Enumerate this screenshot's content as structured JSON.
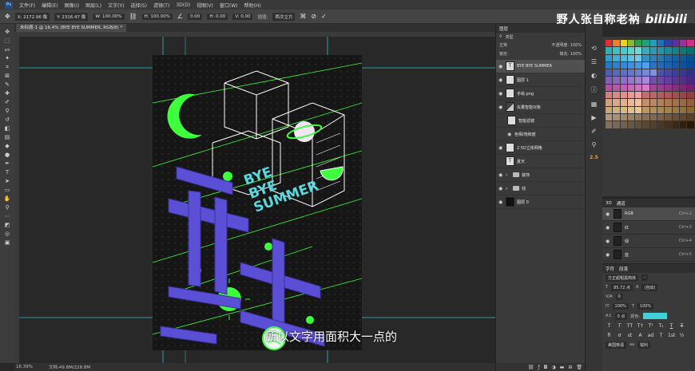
{
  "menubar": {
    "logo": "Ps",
    "items": [
      "文件(F)",
      "编辑(E)",
      "图像(I)",
      "图层(L)",
      "文字(Y)",
      "选择(S)",
      "滤镜(T)",
      "3D(D)",
      "视图(V)",
      "窗口(W)",
      "帮助(H)"
    ]
  },
  "options": {
    "x": "X: 2172.96 像",
    "y": "Y: 2316.47 像",
    "w": "W: 100.00%",
    "h": "H: 100.00%",
    "angle": "0.00",
    "hskew": "H: 0.00",
    "vskew": "V: 0.00",
    "interp_label": "插值:",
    "interp_value": "两次立方"
  },
  "watermark": {
    "text": "野人张自称老衲",
    "logo": "bilibili"
  },
  "document": {
    "tab_title": "未标题-1 @ 16.4% (BYE BYE SUMMER, RGB/8) *"
  },
  "poster": {
    "text_lines": [
      "BYE",
      "BYE",
      "SUMMER"
    ],
    "colors": {
      "green": "#3dff3d",
      "purple": "#5b4fd6",
      "cyan": "#5ad8e0"
    }
  },
  "subtitle": "所以文字用面积大一点的",
  "status": {
    "zoom": "16.39%",
    "doc": "文档:49.8M/228.8M"
  },
  "layers_panel": {
    "tab": "图层",
    "filter": "类型",
    "blend": "正常",
    "opacity_label": "不透明度:",
    "opacity": "100%",
    "lock_label": "锁定:",
    "fill_label": "填充:",
    "fill": "100%",
    "layers": [
      {
        "name": "BYE BYE SUMMER",
        "kind": "T",
        "selected": true
      },
      {
        "name": "图层 1",
        "kind": "img"
      },
      {
        "name": "手绘.png",
        "kind": "img"
      },
      {
        "name": "矢量智能对象",
        "kind": "img"
      },
      {
        "name": "智能滤镜",
        "kind": "filter"
      },
      {
        "name": "色相/饱和度",
        "kind": "sub"
      },
      {
        "name": "2.5D立体网格",
        "kind": "img"
      },
      {
        "name": "夏天",
        "kind": "T"
      },
      {
        "name": "装饰",
        "kind": "folder"
      },
      {
        "name": "线",
        "kind": "folder"
      },
      {
        "name": "图层 0",
        "kind": "dark"
      }
    ]
  },
  "channels_panel": {
    "tabs": [
      "3D",
      "通道"
    ],
    "channels": [
      {
        "name": "RGB",
        "key": "Ctrl+2"
      },
      {
        "name": "红",
        "key": "Ctrl+3"
      },
      {
        "name": "绿",
        "key": "Ctrl+4"
      },
      {
        "name": "蓝",
        "key": "Ctrl+5"
      }
    ]
  },
  "character_panel": {
    "tabs": [
      "字符",
      "段落"
    ],
    "font": "方正超粗黑简体",
    "style": "-",
    "size": "85.72 点",
    "leading": "(自动)",
    "tracking": "0",
    "vscale": "100%",
    "hscale": "100%",
    "baseline": "0 点",
    "color_label": "颜色:",
    "language": "美国英语",
    "aa": "锐利"
  },
  "swatch_colors": [
    "#e03030",
    "#f08020",
    "#f0d020",
    "#80c030",
    "#30a040",
    "#20a080",
    "#20a0c0",
    "#2070c0",
    "#3040a0",
    "#6030a0",
    "#a030a0",
    "#d03080",
    "#30b0b0",
    "#40c0c0",
    "#50c8c8",
    "#60d0d0",
    "#70d8d8",
    "#40a8b8",
    "#3098b0",
    "#2890a8",
    "#208898",
    "#188088",
    "#107878",
    "#087070",
    "#30a0c8",
    "#40b0d0",
    "#50b8d8",
    "#60c0e0",
    "#70c8e8",
    "#3890c0",
    "#3080b8",
    "#2878b0",
    "#2068a8",
    "#1860a0",
    "#105898",
    "#085090",
    "#2878c8",
    "#3080d0",
    "#3888d8",
    "#4090e0",
    "#4898e8",
    "#50a0f0",
    "#3070c0",
    "#2868b8",
    "#2060b0",
    "#1858a8",
    "#1050a0",
    "#084898",
    "#5060b0",
    "#5868b8",
    "#6070c0",
    "#6878c8",
    "#7080d0",
    "#7888d8",
    "#8090e0",
    "#5050a8",
    "#4848a0",
    "#404098",
    "#383890",
    "#303088",
    "#8060b0",
    "#8868b8",
    "#9070c0",
    "#9878c8",
    "#a080d0",
    "#a888d8",
    "#7050a8",
    "#6848a0",
    "#604098",
    "#583890",
    "#503088",
    "#482880",
    "#b050a0",
    "#b858a8",
    "#c060b0",
    "#c868b8",
    "#d070c0",
    "#d878c8",
    "#a04898",
    "#984090",
    "#903888",
    "#883080",
    "#802878",
    "#782070",
    "#d08080",
    "#d88888",
    "#e09090",
    "#e89898",
    "#f0a0a0",
    "#c07070",
    "#b86868",
    "#b06060",
    "#a85858",
    "#a05050",
    "#984848",
    "#904040",
    "#d0a080",
    "#d8a888",
    "#e0b090",
    "#e8b898",
    "#f0c0a0",
    "#c09070",
    "#b88868",
    "#b08060",
    "#a87858",
    "#a07050",
    "#986848",
    "#906040",
    "#c8a878",
    "#d0b080",
    "#d8b888",
    "#e0c090",
    "#e8c898",
    "#b89868",
    "#b09060",
    "#a88858",
    "#a08050",
    "#987848",
    "#907040",
    "#886838",
    "#b09880",
    "#a89078",
    "#a08870",
    "#988068",
    "#907860",
    "#887058",
    "#806850",
    "#786048",
    "#705840",
    "#685038",
    "#604830",
    "#584028",
    "#807060",
    "#786858",
    "#706050",
    "#685848",
    "#605040",
    "#584838",
    "#504030",
    "#483828",
    "#403020",
    "#382818",
    "#302010",
    "#281808"
  ]
}
